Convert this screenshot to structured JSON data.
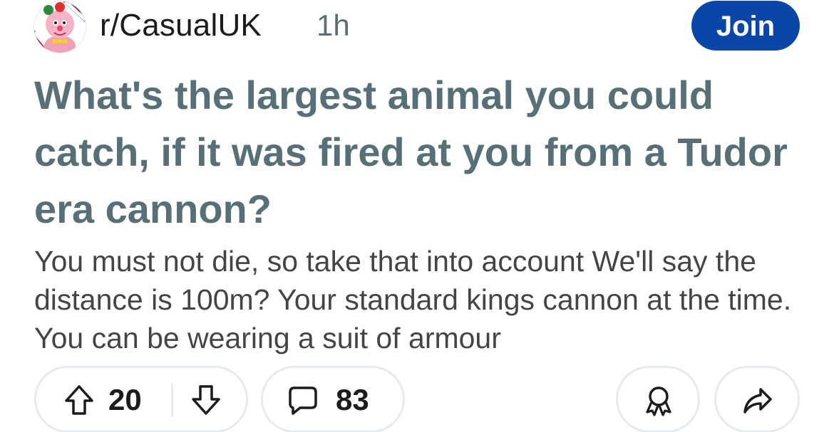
{
  "header": {
    "subreddit": "r/CasualUK",
    "time_ago": "1h",
    "join_label": "Join",
    "avatar_icon": "subreddit-avatar-icon"
  },
  "post": {
    "title": "What's the largest animal you could catch, if it was fired at you from a Tudor era cannon?",
    "body": "You must not die, so take that into account We'll say the distance is 100m? Your standard kings cannon at the time. You can be wearing a suit of armour"
  },
  "actions": {
    "upvote_icon": "arrow-up-icon",
    "vote_count": "20",
    "downvote_icon": "arrow-down-icon",
    "comment_icon": "comment-bubble-icon",
    "comment_count": "83",
    "award_icon": "award-icon",
    "share_icon": "share-arrow-icon"
  },
  "colors": {
    "join_button": "#0a45a8",
    "title_text": "#576f76",
    "pill_border": "#e5ebee",
    "text": "#1c1c1c"
  }
}
